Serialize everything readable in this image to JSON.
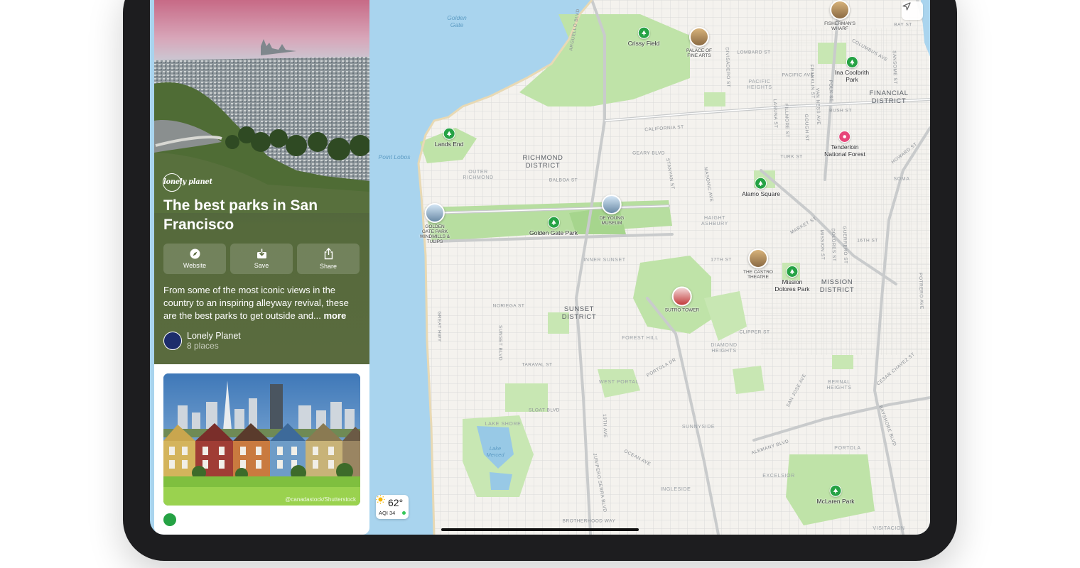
{
  "guide": {
    "publisher": "lonely planet",
    "title": "The best parks in San Francisco",
    "actions": {
      "website": "Website",
      "save": "Save",
      "share": "Share"
    },
    "description": "From some of the most iconic views in the country to an inspiring alleyway revival, these are the best parks to get outside and...",
    "more": "more",
    "author": "Lonely Planet",
    "place_count": "8 places"
  },
  "photo_card": {
    "credit": "@canadastock/Shutterstock"
  },
  "weather": {
    "temperature": "62°",
    "aqi": "AQI 34"
  },
  "map": {
    "districts": {
      "richmond": "RICHMOND\nDISTRICT",
      "sunset": "SUNSET\nDISTRICT",
      "mission": "MISSION\nDISTRICT",
      "financial": "FINANCIAL\nDISTRICT"
    },
    "water": {
      "golden_gate": "Golden\nGate",
      "point_lobos": "Point Lobos"
    },
    "neighborhoods": {
      "outer_richmond": "OUTER\nRICHMOND",
      "inner_sunset": "INNER SUNSET",
      "haight_ashbury": "HAIGHT\nASHBURY",
      "forest_hill": "FOREST HILL",
      "west_portal": "WEST PORTAL",
      "diamond_heights": "DIAMOND\nHEIGHTS",
      "lake_shore": "LAKE SHORE",
      "sunnyside": "SUNNYSIDE",
      "ingleside": "INGLESIDE",
      "excelsior": "EXCELSIOR",
      "portola": "PORTOLA",
      "bernal_heights": "BERNAL\nHEIGHTS",
      "visitacion": "VISITACION",
      "soma": "SOMA",
      "pacific_heights": "PACIFIC\nHEIGHTS"
    },
    "streets": {
      "california": "CALIFORNIA ST",
      "geary": "GEARY BLVD",
      "balboa": "BALBOA ST",
      "noriega": "NORIEGA ST",
      "taraval": "TARAVAL ST",
      "sloat": "SLOAT BLVD",
      "lombard": "LOMBARD ST",
      "bush": "BUSH ST",
      "turk": "TURK ST",
      "market": "MARKET ST",
      "clipper": "CLIPPER ST",
      "seventeenth": "17TH ST",
      "sixteenth": "16TH ST",
      "portola_dr": "PORTOLA DR",
      "ocean_ave": "OCEAN AVE",
      "alemany": "ALEMANY BLVD",
      "brotherhood": "BROTHERHOOD WAY",
      "great_hwy": "GREAT HWY",
      "sunset_blvd": "SUNSET BLVD",
      "columbus": "COLUMBUS AVE",
      "howard": "HOWARD ST",
      "mission_st": "MISSION ST",
      "san_jose": "SAN JOSE AVE",
      "junipero_serra": "JUNIPERO SERRA BLVD",
      "arguello": "ARGUELLO BLVD",
      "stanyan": "STANYAN ST",
      "masonic": "MASONIC AVE",
      "fillmore": "FILLMORE ST",
      "van_ness": "VAN NESS AVE",
      "divisadero": "DIVISADERO ST",
      "gough": "GOUGH ST",
      "polk": "POLK ST",
      "franklin": "FRANKLIN ST",
      "pacific": "PACIFIC AVE",
      "bay": "BAY ST",
      "laguna": "LAGUNA ST",
      "nineteenth": "19TH AVE",
      "potrero": "POTRERO AVE",
      "guerrero": "GUERRERO ST",
      "dolores": "DOLORES ST",
      "bayshore": "BAYSHORE BLVD",
      "cesar_chavez": "CESAR CHAVEZ ST",
      "sansome": "SANSOME ST"
    },
    "places": {
      "crissy_field": "Crissy Field",
      "palace": "PALACE OF\nFINE ARTS",
      "fishermans": "FISHERMAN'S\nWHARF",
      "ina_coolbrith": "Ina Coolbrith\nPark",
      "lands_end": "Lands End",
      "tenderloin": "Tenderloin\nNational Forest",
      "alamo_square": "Alamo Square",
      "golden_gate_park": "Golden Gate Park",
      "windmill": "GOLDEN\nGATE PARK\nWINDMILLS &\nTULIPS",
      "de_young": "DE YOUNG\nMUSEUM",
      "castro": "THE CASTRO\nTHEATRE",
      "mission_dolores": "Mission\nDolores Park",
      "sutro": "SUTRO TOWER",
      "mclaren": "McLaren Park",
      "lake_merced": "Lake\nMerced"
    }
  },
  "colors": {
    "park_green": "#25a244",
    "water": "#a9d4ee",
    "land": "#f4f2ee",
    "panel_bg": "#5a6b3e"
  }
}
